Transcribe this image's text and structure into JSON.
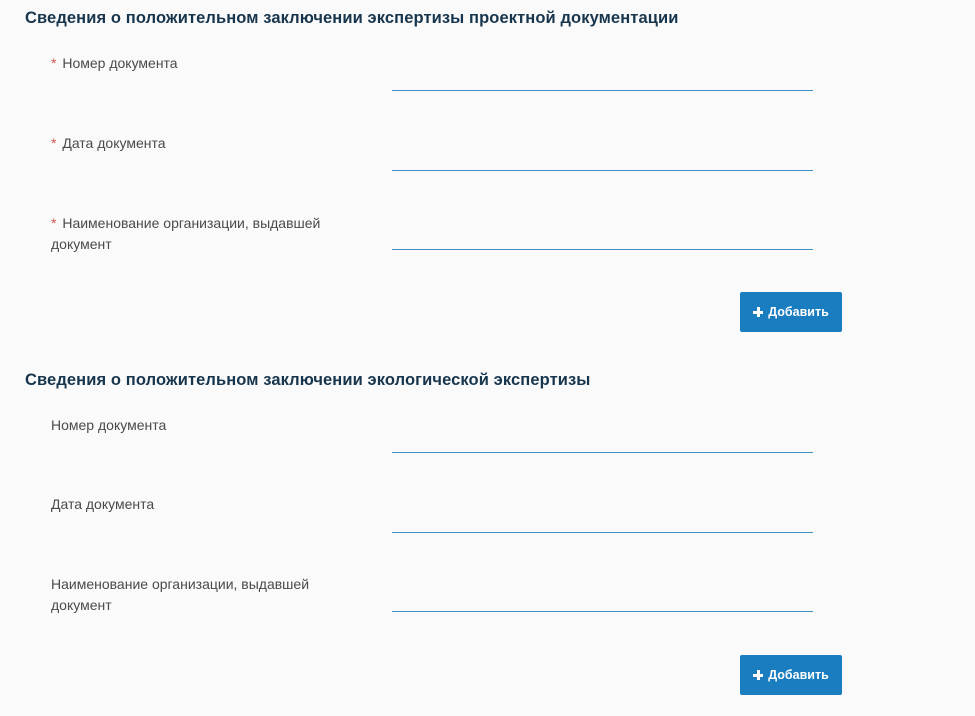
{
  "sections": [
    {
      "title": "Сведения о положительном заключении экспертизы проектной документации",
      "fields": [
        {
          "required_mark": "*",
          "label": "Номер документа",
          "value": ""
        },
        {
          "required_mark": "*",
          "label": "Дата документа",
          "value": ""
        },
        {
          "required_mark": "*",
          "label": "Наименование организации, выдавшей документ",
          "value": ""
        }
      ],
      "add_label": "Добавить"
    },
    {
      "title": "Сведения о положительном заключении экологической экспертизы",
      "fields": [
        {
          "label": "Номер документа",
          "value": ""
        },
        {
          "label": "Дата документа",
          "value": ""
        },
        {
          "label": "Наименование организации, выдавшей документ",
          "value": ""
        }
      ],
      "add_label": "Добавить"
    }
  ],
  "icons": {
    "add": "plus-icon"
  },
  "colors": {
    "title": "#17354d",
    "accent": "#1a7dc0",
    "required": "#d9534f",
    "underline": "#3f8fc2"
  }
}
